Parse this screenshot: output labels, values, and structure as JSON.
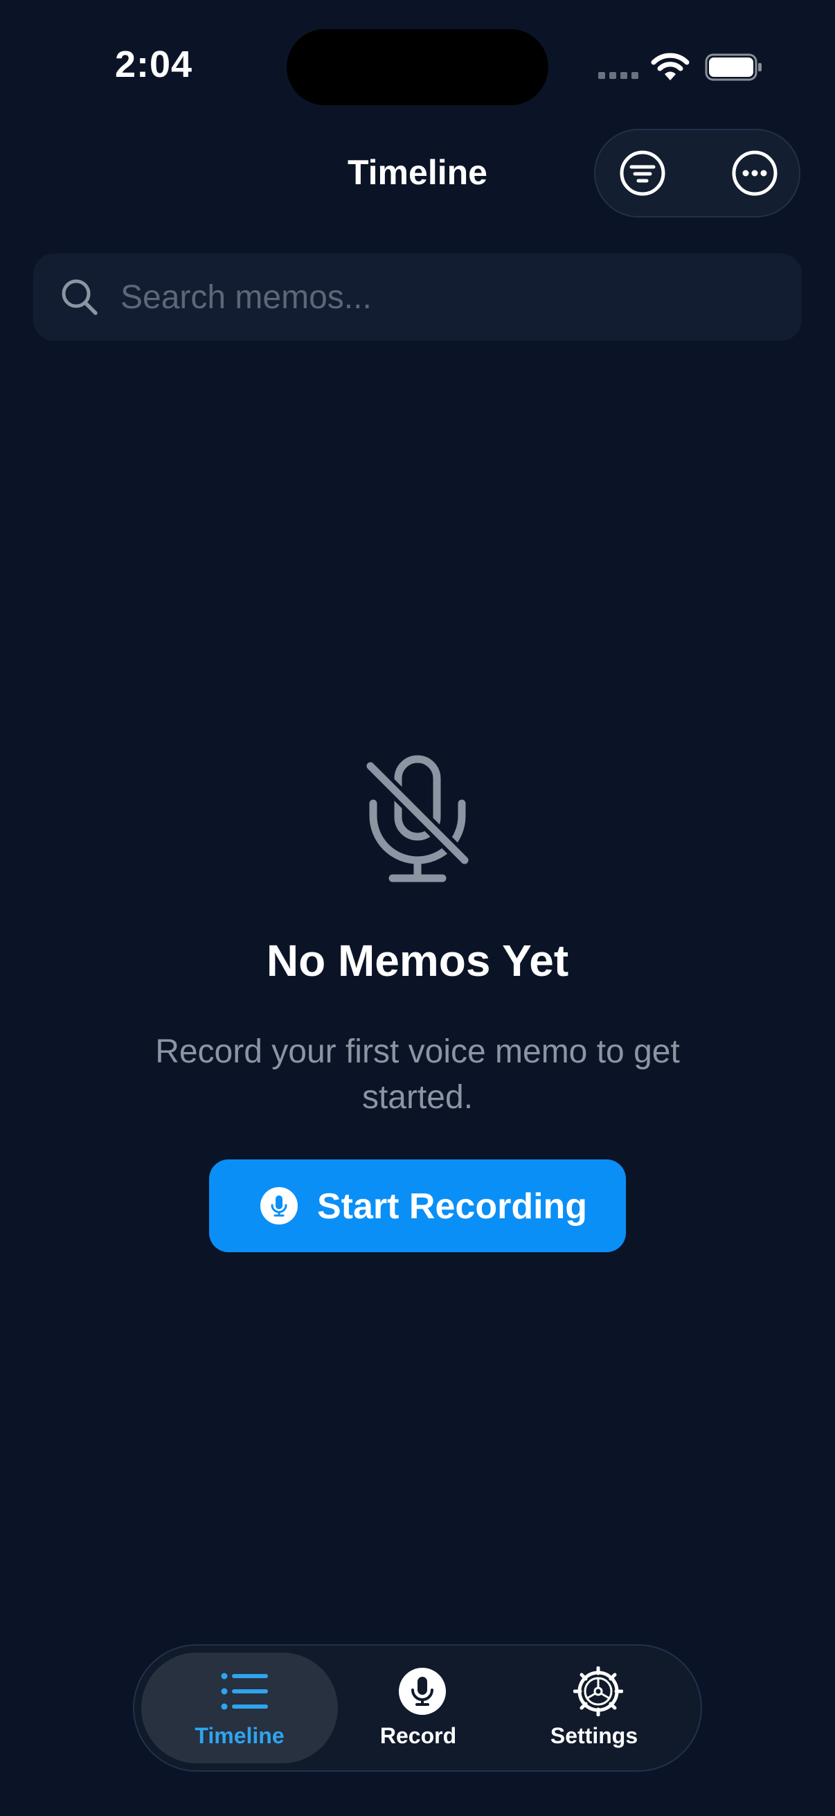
{
  "status_bar": {
    "time": "2:04"
  },
  "header": {
    "title": "Timeline",
    "filter_icon": "filter-icon",
    "more_icon": "ellipsis-icon"
  },
  "search": {
    "placeholder": "Search memos...",
    "value": "",
    "icon": "search-icon"
  },
  "empty_state": {
    "icon": "mic-slash-icon",
    "title": "No Memos Yet",
    "subtitle": "Record your first voice memo to get started.",
    "button_label": "Start Recording",
    "button_icon": "mic-circle-icon"
  },
  "tab_bar": {
    "items": [
      {
        "label": "Timeline",
        "icon": "list-icon",
        "selected": true
      },
      {
        "label": "Record",
        "icon": "mic-circle-icon",
        "selected": false
      },
      {
        "label": "Settings",
        "icon": "gear-icon",
        "selected": false
      }
    ]
  },
  "colors": {
    "background": "#0b1427",
    "accent": "#0a8ff7",
    "selected_tab": "#2fa4f0",
    "muted_text": "#8d94a2"
  }
}
